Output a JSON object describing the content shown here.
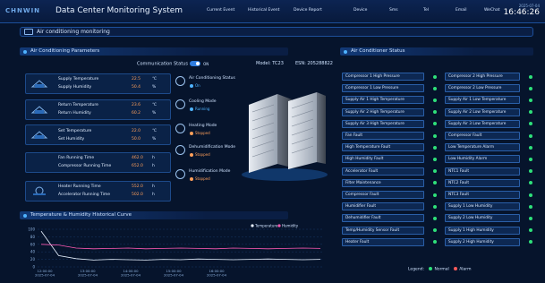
{
  "header": {
    "logo": "CHNWIN",
    "title": "Data Center Monitoring System",
    "nav": [
      "Current Event",
      "Historical Event",
      "Device Report",
      "Device",
      "Sms",
      "Tel",
      "Email",
      "WeChat"
    ],
    "date": "2025-07-04",
    "time": "16:46:26"
  },
  "breadcrumb": {
    "label": "Air conditioning monitoring"
  },
  "params": {
    "section_title": "Air Conditioning Parameters",
    "communication_label": "Communication Status",
    "communication_toggle": "ON",
    "model_label": "Model:",
    "model_value": "TC23",
    "esn_label": "ESN:",
    "esn_value": "205288822",
    "rows": [
      {
        "label": "Supply Temperature",
        "value": "22.5",
        "unit": "℃"
      },
      {
        "label": "Supply Humidity",
        "value": "50.4",
        "unit": "%"
      },
      {
        "label": "Return Temperature",
        "value": "23.6",
        "unit": "℃"
      },
      {
        "label": "Return Humidity",
        "value": "60.2",
        "unit": "%"
      },
      {
        "label": "Set Temperature",
        "value": "22.0",
        "unit": "℃"
      },
      {
        "label": "Set Humidity",
        "value": "50.0",
        "unit": "%"
      },
      {
        "label": "Fan Running Time",
        "value": "462.0",
        "unit": "h"
      },
      {
        "label": "Compressor Running Time",
        "value": "652.0",
        "unit": "h"
      },
      {
        "label": "Heater Running Time",
        "value": "552.0",
        "unit": "h"
      },
      {
        "label": "Accelerator Running Time",
        "value": "502.0",
        "unit": "h"
      }
    ],
    "modes": [
      {
        "label": "Air Conditioning Status",
        "status": "On",
        "color": "#4fb3ff"
      },
      {
        "label": "Cooling Mode",
        "status": "Running",
        "color": "#4fb3ff"
      },
      {
        "label": "Heating Mode",
        "status": "Stopped",
        "color": "#ff9f5a"
      },
      {
        "label": "Dehumidification Mode",
        "status": "Stopped",
        "color": "#ff9f5a"
      },
      {
        "label": "Humidification Mode",
        "status": "Stopped",
        "color": "#ff9f5a"
      }
    ]
  },
  "status": {
    "section_title": "Air Conditioner Status",
    "left": [
      "Compressor 1 High Pressure",
      "Compressor 1 Low Pressure",
      "Supply Air 1 High Temperature",
      "Supply Air 2 High Temperature",
      "Supply Air 3 High Temperature",
      "Fan Fault",
      "High Temperature Fault",
      "High Humidity Fault",
      "Accelerator Fault",
      "Filter Maintenance",
      "Compressor Fault",
      "Humidifier Fault",
      "Dehumidifier Fault",
      "Temp/Humidity Sensor Fault",
      "Heater Fault"
    ],
    "right": [
      "Compressor 2 High Pressure",
      "Compressor 2 Low Pressure",
      "Supply Air 1 Low Temperature",
      "Supply Air 2 Low Temperature",
      "Supply Air 3 Low Temperature",
      "Compressor Fault",
      "Low Temperature Alarm",
      "Low Humidity Alarm",
      "NTC1 Fault",
      "NTC2 Fault",
      "NTC3 Fault",
      "Supply 1 Low Humidity",
      "Supply 2 Low Humidity",
      "Supply 1 High Humidity",
      "Supply 2 High Humidity"
    ],
    "legend_label": "Legend:",
    "legend_normal": "Normal",
    "legend_alarm": "Alarm",
    "normal_color": "#2ee07a",
    "alarm_color": "#ff5a5a"
  },
  "chart_title": "Temperature & Humidity Historical Curve",
  "chart_data": {
    "type": "line",
    "x": [
      "12:00:00\n2025-07-04",
      "13:00:00\n2025-07-04",
      "14:00:00\n2025-07-04",
      "15:00:00\n2025-07-04",
      "16:00:00\n2025-07-04"
    ],
    "yticks": [
      0,
      20,
      40,
      60,
      80,
      100
    ],
    "ylim": [
      0,
      100
    ],
    "series": [
      {
        "name": "Temperature",
        "color": "#e8f2ff",
        "values": [
          95,
          30,
          22,
          18,
          20,
          19,
          18,
          20,
          19,
          21,
          20,
          19,
          20,
          21,
          20,
          19,
          20
        ]
      },
      {
        "name": "Humidity",
        "color": "#ff5ab4",
        "values": [
          60,
          58,
          50,
          48,
          49,
          50,
          48,
          49,
          50,
          49,
          48,
          50,
          49,
          48,
          49,
          50,
          49
        ]
      }
    ]
  }
}
